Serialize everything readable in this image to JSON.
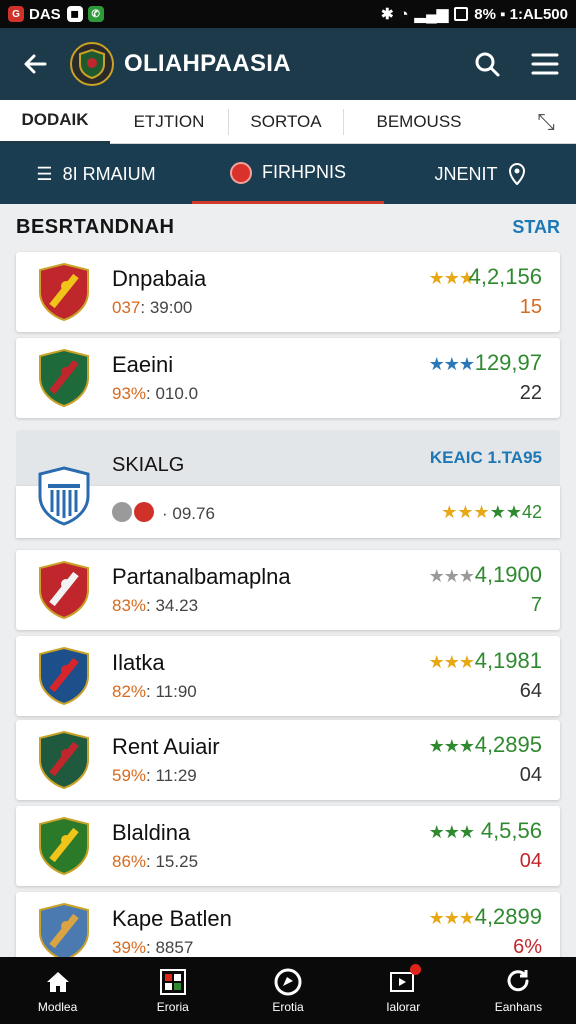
{
  "status_bar": {
    "left_text": "DAS",
    "right_text": "8% ▪ 1:AL500",
    "colors": {
      "bg": "#0a0a0a"
    }
  },
  "app_bar": {
    "title": "OLIAHPAASIA",
    "icons": [
      "arrow-left-icon",
      "search-icon",
      "menu-icon"
    ],
    "bg": "#1d3a4a"
  },
  "tabs": [
    {
      "label": "DODAIK",
      "selected": true
    },
    {
      "label": "ETJTION",
      "selected": false
    },
    {
      "label": "SORTOA",
      "selected": false
    },
    {
      "label": "BEMOUSS",
      "selected": false
    }
  ],
  "subnav": [
    {
      "label": "8I RMAIUM",
      "icon": "stack-icon"
    },
    {
      "label": "FIRHPNIS",
      "icon": "record-icon",
      "active": true
    },
    {
      "label": "JNENIT",
      "icon": "location-icon"
    }
  ],
  "section": {
    "title": "BESRTANDNAH",
    "link": "STAR"
  },
  "teams": [
    {
      "name": "Dnpabaia",
      "pct": "037",
      "time": ": 39:00",
      "stars": "★★★",
      "star_color": "#e6a817",
      "score": "4,2,156",
      "score_color": "#2f8a2f",
      "rank": "15",
      "rank_color": "#d66a1e",
      "shield": [
        "#c0272d",
        "#f0c419"
      ]
    },
    {
      "name": "Eaeini",
      "pct": "93%",
      "time": ": 010.0",
      "stars": "★★★",
      "star_color": "#2b78b8",
      "score": "129,97",
      "score_color": "#2f8a2f",
      "rank": "22",
      "rank_color": "#333",
      "shield": [
        "#1f6a3a",
        "#c0272d"
      ]
    },
    {
      "name": "Partanalbamaplna",
      "pct": "83%",
      "time": ": 34.23",
      "stars": "★★★",
      "star_color": "#9a9a9a",
      "score": "4,1900",
      "score_color": "#2f8a2f",
      "rank": "7",
      "rank_color": "#2f8a2f",
      "shield": [
        "#c0272d",
        "#f3f3f3"
      ]
    },
    {
      "name": "Ilatka",
      "pct": "82%",
      "time": ": 11:90",
      "stars": "★★★",
      "star_color": "#e6a817",
      "score": "4,1981",
      "score_color": "#2f8a2f",
      "rank": "64",
      "rank_color": "#333",
      "shield": [
        "#1d4f8a",
        "#d6262b"
      ]
    },
    {
      "name": "Rent Auiair",
      "pct": "59%",
      "time": ": 11:29",
      "stars": "★★★",
      "star_color": "#2f8a2f",
      "score": "4,2895",
      "score_color": "#2f8a2f",
      "rank": "04",
      "rank_color": "#333",
      "shield": [
        "#1f5a3f",
        "#c0272d"
      ]
    },
    {
      "name": "Blaldina",
      "pct": "86%",
      "time": ": 15.25",
      "stars": "★★★",
      "star_color": "#2f8a2f",
      "score": "4,5,56",
      "score_color": "#2f8a2f",
      "rank": "04",
      "rank_color": "#c0272d",
      "shield": [
        "#2a7a2a",
        "#f0c419"
      ]
    },
    {
      "name": "Kape Batlen",
      "pct": "39%",
      "time": ": 8857",
      "stars": "★★★",
      "star_color": "#e6a817",
      "score": "4,2899",
      "score_color": "#2f8a2f",
      "rank": "6%",
      "rank_color": "#c0272d",
      "shield": [
        "#4a7ab0",
        "#d9a441"
      ]
    }
  ],
  "featured": {
    "name": "SKIALG",
    "link": "KEAIC 1.TA95",
    "meta": "· 09.76",
    "stars": "★★★★★42",
    "shield": [
      "#2a6bb0",
      "#ffffff"
    ]
  },
  "bottom_nav": [
    {
      "label": "Modlea",
      "icon": "home-icon"
    },
    {
      "label": "Eroria",
      "icon": "grid-icon"
    },
    {
      "label": "Erotia",
      "icon": "compass-icon"
    },
    {
      "label": "Ialorar",
      "icon": "video-icon",
      "badge": true
    },
    {
      "label": "Eanhans",
      "icon": "refresh-icon"
    }
  ]
}
